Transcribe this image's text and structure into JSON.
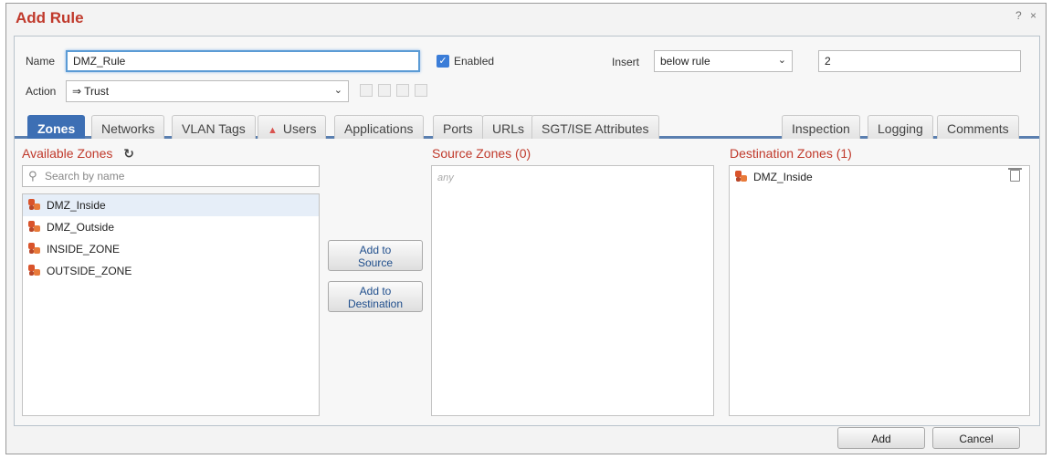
{
  "dialog": {
    "title": "Add Rule",
    "help": "?",
    "close": "×"
  },
  "form": {
    "name_label": "Name",
    "name_value": "DMZ_Rule",
    "enabled_label": "Enabled",
    "enabled_checked": true,
    "insert_label": "Insert",
    "insert_value": "below rule",
    "insert_position": "2",
    "action_label": "Action",
    "action_value": "Trust"
  },
  "tabs": [
    {
      "label": "Zones",
      "active": true
    },
    {
      "label": "Networks"
    },
    {
      "label": "VLAN Tags"
    },
    {
      "label": "Users"
    },
    {
      "label": "Applications"
    },
    {
      "label": "Ports"
    },
    {
      "label": "URLs"
    },
    {
      "label": "SGT/ISE Attributes"
    },
    {
      "label": "Inspection"
    },
    {
      "label": "Logging"
    },
    {
      "label": "Comments"
    }
  ],
  "available": {
    "heading": "Available Zones",
    "search_placeholder": "Search by name",
    "items": [
      "DMZ_Inside",
      "DMZ_Outside",
      "INSIDE_ZONE",
      "OUTSIDE_ZONE"
    ]
  },
  "buttons": {
    "add_to_source_l1": "Add to",
    "add_to_source_l2": "Source",
    "add_to_dest_l1": "Add to",
    "add_to_dest_l2": "Destination",
    "add": "Add",
    "cancel": "Cancel"
  },
  "source": {
    "heading": "Source Zones (0)",
    "empty": "any"
  },
  "destination": {
    "heading": "Destination Zones (1)",
    "items": [
      "DMZ_Inside"
    ]
  },
  "colors": {
    "accent_red": "#c0392b",
    "tab_active": "#3d6fb4"
  }
}
